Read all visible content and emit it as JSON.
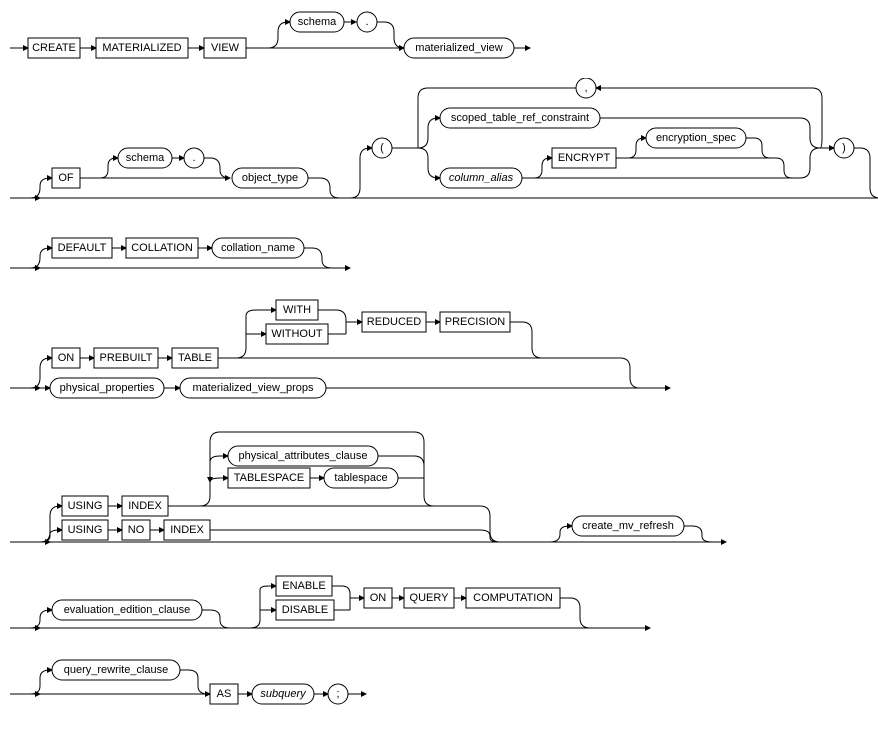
{
  "diagram": {
    "name": "create_materialized_view",
    "row1": {
      "CREATE": "CREATE",
      "MATERIALIZED": "MATERIALIZED",
      "VIEW": "VIEW",
      "schema": "schema",
      "dot": ".",
      "materialized_view": "materialized_view"
    },
    "row2": {
      "OF": "OF",
      "schema": "schema",
      "dot": ".",
      "object_type": "object_type",
      "lparen": "(",
      "scoped_table_ref_constraint": "scoped_table_ref_constraint",
      "column_alias": "column_alias",
      "ENCRYPT": "ENCRYPT",
      "encryption_spec": "encryption_spec",
      "comma": ",",
      "rparen": ")"
    },
    "row3": {
      "DEFAULT": "DEFAULT",
      "COLLATION": "COLLATION",
      "collation_name": "collation_name"
    },
    "row4": {
      "ON": "ON",
      "PREBUILT": "PREBUILT",
      "TABLE": "TABLE",
      "WITH": "WITH",
      "WITHOUT": "WITHOUT",
      "REDUCED": "REDUCED",
      "PRECISION": "PRECISION",
      "physical_properties": "physical_properties",
      "materialized_view_props": "materialized_view_props"
    },
    "row5": {
      "USING": "USING",
      "INDEX": "INDEX",
      "NO": "NO",
      "physical_attributes_clause": "physical_attributes_clause",
      "TABLESPACE": "TABLESPACE",
      "tablespace": "tablespace",
      "create_mv_refresh": "create_mv_refresh"
    },
    "row6": {
      "evaluation_edition_clause": "evaluation_edition_clause",
      "ENABLE": "ENABLE",
      "DISABLE": "DISABLE",
      "ON": "ON",
      "QUERY": "QUERY",
      "COMPUTATION": "COMPUTATION"
    },
    "row7": {
      "query_rewrite_clause": "query_rewrite_clause",
      "AS": "AS",
      "subquery": "subquery",
      "semi": ";"
    }
  }
}
